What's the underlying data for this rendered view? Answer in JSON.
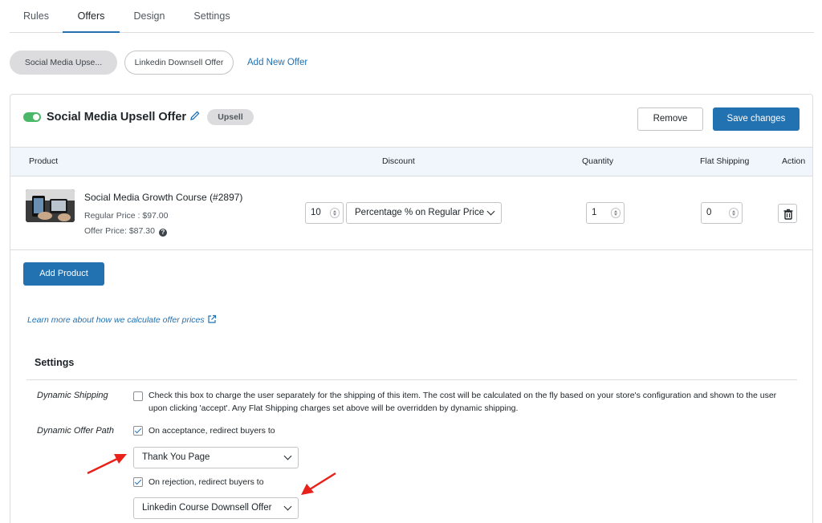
{
  "tabs": [
    {
      "label": "Rules"
    },
    {
      "label": "Offers"
    },
    {
      "label": "Design"
    },
    {
      "label": "Settings"
    }
  ],
  "active_tab": "Offers",
  "offer_pills": [
    {
      "label": "Social Media Upse...",
      "selected": true
    },
    {
      "label": "Linkedin Downsell Offer",
      "selected": false
    }
  ],
  "add_offer_label": "Add New Offer",
  "offer": {
    "enabled": true,
    "title": "Social Media Upsell Offer",
    "type_badge": "Upsell",
    "remove_label": "Remove",
    "save_label": "Save changes"
  },
  "table": {
    "headers": {
      "product": "Product",
      "discount": "Discount",
      "quantity": "Quantity",
      "flat_shipping": "Flat Shipping",
      "action": "Action"
    },
    "rows": [
      {
        "product_name": "Social Media Growth Course (#2897)",
        "regular_price": "Regular Price : $97.00",
        "offer_price": "Offer Price: $87.30",
        "discount_value": "10",
        "discount_type": "Percentage % on Regular Price",
        "quantity": "1",
        "flat_shipping": "0"
      }
    ]
  },
  "add_product_label": "Add Product",
  "learn_more_text": "Learn more about how we calculate offer prices",
  "settings": {
    "heading": "Settings",
    "dynamic_shipping": {
      "label": "Dynamic Shipping",
      "checked": false,
      "description": "Check this box to charge the user separately for the shipping of this item. The cost will be calculated on the fly based on your store's configuration and shown to the user upon clicking 'accept'. Any Flat Shipping charges set above will be overridden by dynamic shipping."
    },
    "dynamic_offer_path": {
      "label": "Dynamic Offer Path",
      "acceptance_label": "On acceptance, redirect buyers to",
      "acceptance_checked": true,
      "acceptance_target": "Thank You Page",
      "rejection_label": "On rejection, redirect buyers to",
      "rejection_checked": true,
      "rejection_target": "Linkedin Course Downsell Offer"
    }
  },
  "colors": {
    "accent": "#2271b1",
    "toggle_on": "#4ab866",
    "annotation_arrow": "#e8221b"
  }
}
